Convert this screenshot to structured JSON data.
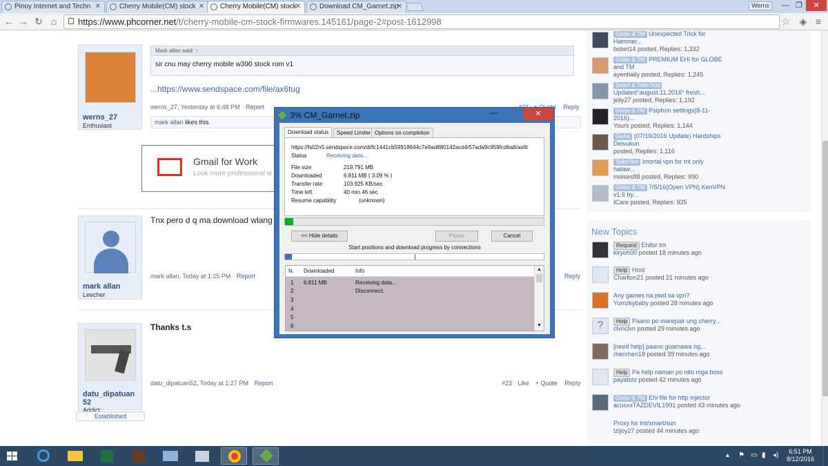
{
  "browser": {
    "tabs": [
      {
        "label": "Pinoy Internet and Techn",
        "active": false
      },
      {
        "label": "Cherry Mobile(CM) stock",
        "active": false
      },
      {
        "label": "Cherry Mobile(CM) stock",
        "active": true
      },
      {
        "label": "Download CM_Garnet.zip",
        "active": false
      }
    ],
    "user": "Werns",
    "url_host": "https://www.phcorner.net",
    "url_path": "/t/cherry-mobile-cm-stock-firmwares.145161/page-2#post-1612998"
  },
  "posts": [
    {
      "username": "werns_27",
      "user_title": "Enthusiast",
      "quote_header": "Mark allan said: ↑",
      "quote_body": "sir cnu may cherry mobile w390 stock rom v1",
      "link_text": "...https://www.sendspace.com/file/ax6tug",
      "author_time": "werns_27, Yesterday at 6:48 PM",
      "report": "Report",
      "number": "#21",
      "like": "Like",
      "quote": "+ Quote",
      "reply": "Reply",
      "likes_user": "mark allan",
      "likes_text": " likes this."
    },
    {
      "username": "mark allan",
      "user_title": "Leecher",
      "body": "Tnx pero d q ma download wlang",
      "author_time": "mark allan, Today at 1:25 PM",
      "report": "Report",
      "reply": "Reply"
    },
    {
      "username": "datu_dipatuan",
      "username2": "52",
      "user_title": "Addict",
      "badge": "Established",
      "body": "Thanks t.s",
      "author_time": "datu_dipatuan52, Today at 1:27 PM",
      "report": "Report",
      "number": "#23",
      "like": "Like",
      "quote": "+ Quote",
      "reply": "Reply"
    }
  ],
  "ad": {
    "title": "Gmail for Work",
    "sub": "Look more professional w"
  },
  "sidebar": {
    "threads": [
      {
        "tag": "Globe & TM",
        "title": "Unexpected Trick for",
        "title2": "Hammer...",
        "meta": "bobet14 posted, Replies: 1,332"
      },
      {
        "tag": "",
        "title": "PREMIUM EHI for GLOBE",
        "title2": "and TM",
        "meta": "ayenhaily posted, Replies: 1,245",
        "tag_inline": "Globe & TM"
      },
      {
        "tag": "Smart & TalknText",
        "title": "",
        "title2": "Updated°august.11.2016° fresh...",
        "meta": "jelly27 posted, Replies: 1,192"
      },
      {
        "tag": "Globe & TM",
        "title": "Psiphon settings(8-11-",
        "title2": "2016)...",
        "meta": "Yours posted, Replies: 1,144"
      },
      {
        "tag": "Globe",
        "title": "(07/19/2016 Update) Hardships",
        "title2": "Deivukun",
        "meta": "posted, Replies: 1,116"
      },
      {
        "tag": "TalknText",
        "title": "Imortal vpn for tnt only",
        "title2": "hataw...",
        "meta": "moises88 posted, Replies: 990"
      },
      {
        "tag": "Globe & TM",
        "title": "7/5/16(Open VPN) KenVPN",
        "title2": "v1.6 by...",
        "meta": "ICare posted, Replies: 925"
      }
    ],
    "new_topics_title": "New Topics",
    "new_topics": [
      {
        "tag": "Request",
        "title": "Ehifor tnt",
        "user": "kiryoh00",
        "time": " posted 18 minutes ago"
      },
      {
        "tag": "Help",
        "title": "Host",
        "user": "Charlton21",
        "time": " posted 21 minutes ago"
      },
      {
        "tag": "",
        "title": "Any games na pwd sa vpn?",
        "user": "Yumzkybaby",
        "time": " posted 28 minutes ago"
      },
      {
        "tag": "Help",
        "title": "Paano po marepair ung cherry...",
        "user": "clvnclvn",
        "time": " posted 29 minutes ago"
      },
      {
        "tag": "",
        "title": "[need help] paano guamawa ng...",
        "user": "rhenrhen18",
        "time": " posted 39 minutes ago"
      },
      {
        "tag": "Help",
        "title": "Pa help naman po nito mga boss",
        "user": "payatotz",
        "time": " posted 42 minutes ago"
      },
      {
        "tag": "Globe & TM",
        "title": "Ehi file for http injector",
        "user": "acusxxTAZDEVIL1991",
        "time": " posted 43 minutes ago"
      },
      {
        "tag": "",
        "title": "Proxy for tnt/smart/sun",
        "user": "tzijoy27",
        "time": " posted 44 minutes ago"
      }
    ]
  },
  "download_dialog": {
    "title": "3% CM_Garnet.zip",
    "tabs": [
      "Download status",
      "Speed Limiter",
      "Options on completion"
    ],
    "url": "https://fs02n5.sendspace.com/dl/fc1441cb59918644c7e9ad880142acd4/57ada9c959fcd6a8/ax6t",
    "status_label": "Status",
    "status_value": "Receiving data...",
    "file_size_label": "File size",
    "file_size": "219.791  MB",
    "downloaded_label": "Downloaded",
    "downloaded": "6.811  MB  ( 3.09 % )",
    "rate_label": "Transfer rate",
    "rate": "103.925  KB/sec",
    "time_left_label": "Time left",
    "time_left": "40 min 46 sec",
    "resume_label": "Resume capability",
    "resume": "(unknown)",
    "progress": 0.031,
    "hide_details": "<< Hide details",
    "pause": "Pause",
    "cancel": "Cancel",
    "connections_label": "Start positions and download progress by connections",
    "columns": [
      "N.",
      "Downloaded",
      "Info"
    ],
    "rows": [
      {
        "n": "1",
        "downloaded": "6.811  MB",
        "info": "Receiving data..."
      },
      {
        "n": "2",
        "downloaded": "",
        "info": "Disconnect."
      },
      {
        "n": "3",
        "downloaded": "",
        "info": ""
      },
      {
        "n": "4",
        "downloaded": "",
        "info": ""
      },
      {
        "n": "5",
        "downloaded": "",
        "info": ""
      },
      {
        "n": "6",
        "downloaded": "",
        "info": ""
      }
    ]
  },
  "taskbar": {
    "time": "6:51 PM",
    "date": "8/12/2016"
  }
}
